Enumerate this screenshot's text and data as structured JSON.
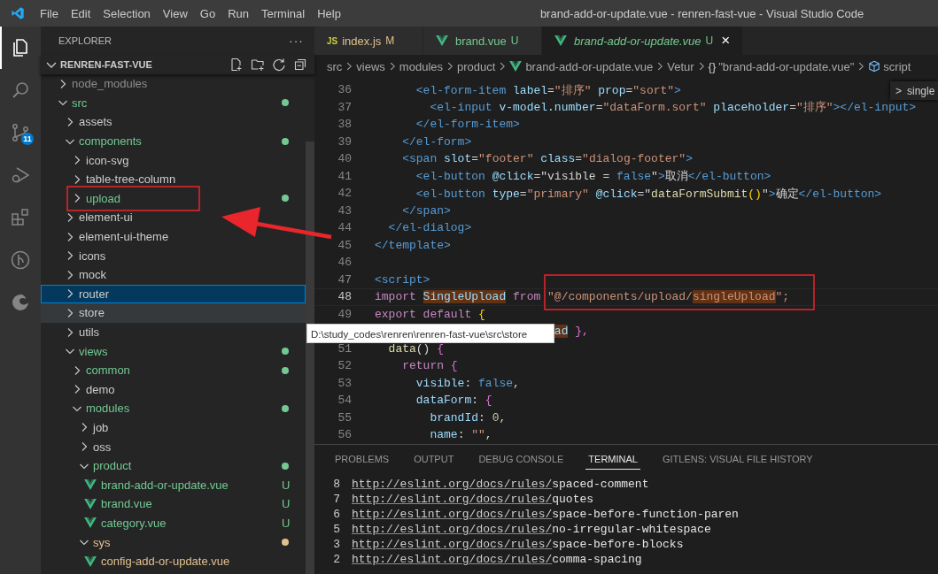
{
  "title_bar": {
    "menu": [
      "File",
      "Edit",
      "Selection",
      "View",
      "Go",
      "Run",
      "Terminal",
      "Help"
    ],
    "title": "brand-add-or-update.vue - renren-fast-vue - Visual Studio Code"
  },
  "activity_bar": [
    {
      "kind": "explorer",
      "selected": true
    },
    {
      "kind": "search",
      "selected": false
    },
    {
      "kind": "source-control",
      "selected": false,
      "badge": "11"
    },
    {
      "kind": "debug",
      "selected": false
    },
    {
      "kind": "extensions",
      "selected": false
    },
    {
      "kind": "git-graph",
      "selected": false
    },
    {
      "kind": "remote",
      "selected": false
    }
  ],
  "explorer": {
    "title": "EXPLORER",
    "more": "···",
    "section": "RENREN-FAST-VUE",
    "tree": [
      {
        "label": "node_modules",
        "kind": "folder",
        "expanded": false,
        "color": "#8c8c8c",
        "dot": false,
        "selected": false,
        "hovered": false
      },
      {
        "label": "src",
        "kind": "folder",
        "expanded": true,
        "color": "#73c991",
        "dot": true,
        "selected": false,
        "hovered": false,
        "children": [
          {
            "label": "assets",
            "kind": "folder",
            "expanded": false,
            "dot": false,
            "selected": false,
            "hovered": false
          },
          {
            "label": "components",
            "kind": "folder",
            "expanded": true,
            "color": "#73c991",
            "dot": true,
            "selected": false,
            "hovered": false,
            "children": [
              {
                "label": "icon-svg",
                "kind": "folder",
                "expanded": false,
                "dot": false,
                "selected": false,
                "hovered": false
              },
              {
                "label": "table-tree-column",
                "kind": "folder",
                "expanded": false,
                "dot": false,
                "selected": false,
                "hovered": false
              },
              {
                "label": "upload",
                "kind": "folder",
                "expanded": false,
                "color": "#73c991",
                "dot": true,
                "selected": false,
                "hovered": false
              }
            ]
          },
          {
            "label": "element-ui",
            "kind": "folder",
            "expanded": false,
            "dot": false,
            "selected": false,
            "hovered": false
          },
          {
            "label": "element-ui-theme",
            "kind": "folder",
            "expanded": false,
            "dot": false,
            "selected": false,
            "hovered": false
          },
          {
            "label": "icons",
            "kind": "folder",
            "expanded": false,
            "dot": false,
            "selected": false,
            "hovered": false
          },
          {
            "label": "mock",
            "kind": "folder",
            "expanded": false,
            "dot": false,
            "selected": false,
            "hovered": false
          },
          {
            "label": "router",
            "kind": "folder",
            "expanded": false,
            "dot": false,
            "selected": true,
            "hovered": false
          },
          {
            "label": "store",
            "kind": "folder",
            "expanded": false,
            "dot": false,
            "selected": false,
            "hovered": true
          },
          {
            "label": "utils",
            "kind": "folder",
            "expanded": false,
            "dot": false,
            "selected": false,
            "hovered": false
          },
          {
            "label": "views",
            "kind": "folder",
            "expanded": true,
            "color": "#73c991",
            "dot": true,
            "selected": false,
            "hovered": false,
            "children": [
              {
                "label": "common",
                "kind": "folder",
                "expanded": false,
                "color": "#73c991",
                "dot": true,
                "selected": false,
                "hovered": false
              },
              {
                "label": "demo",
                "kind": "folder",
                "expanded": false,
                "dot": false,
                "selected": false,
                "hovered": false
              },
              {
                "label": "modules",
                "kind": "folder",
                "expanded": true,
                "color": "#73c991",
                "dot": true,
                "selected": false,
                "hovered": false,
                "children": [
                  {
                    "label": "job",
                    "kind": "folder",
                    "expanded": false,
                    "dot": false,
                    "selected": false,
                    "hovered": false
                  },
                  {
                    "label": "oss",
                    "kind": "folder",
                    "expanded": false,
                    "dot": false,
                    "selected": false,
                    "hovered": false
                  },
                  {
                    "label": "product",
                    "kind": "folder",
                    "expanded": true,
                    "color": "#73c991",
                    "dot": true,
                    "selected": false,
                    "hovered": false,
                    "children": [
                      {
                        "label": "brand-add-or-update.vue",
                        "kind": "file",
                        "color": "#73c991",
                        "badge": "U",
                        "selected": false,
                        "hovered": false
                      },
                      {
                        "label": "brand.vue",
                        "kind": "file",
                        "color": "#73c991",
                        "badge": "U",
                        "selected": false,
                        "hovered": false
                      },
                      {
                        "label": "category.vue",
                        "kind": "file",
                        "color": "#73c991",
                        "badge": "U",
                        "selected": false,
                        "hovered": false
                      }
                    ]
                  },
                  {
                    "label": "sys",
                    "kind": "folder",
                    "expanded": true,
                    "color": "#e2c08d",
                    "dot": true,
                    "selected": false,
                    "hovered": false,
                    "children": [
                      {
                        "label": "config-add-or-update.vue",
                        "kind": "file",
                        "color": "#e2c08d",
                        "selected": false,
                        "hovered": false
                      }
                    ]
                  }
                ]
              }
            ]
          }
        ]
      }
    ],
    "tooltip": "D:\\study_codes\\renren\\renren-fast-vue\\src\\store"
  },
  "tabs": [
    {
      "label": "index.js",
      "kind": "js",
      "icon_label": "JS",
      "badge": "M",
      "color": "#e2c08d",
      "selected": false,
      "preview": false
    },
    {
      "label": "brand.vue",
      "kind": "vue",
      "badge": "U",
      "color": "#73c991",
      "selected": false,
      "preview": false
    },
    {
      "label": "brand-add-or-update.vue",
      "kind": "vue",
      "badge": "U",
      "color": "#73c991",
      "selected": true,
      "preview": true,
      "close": "×"
    }
  ],
  "breadcrumbs": [
    {
      "label": "src",
      "kind": "folder"
    },
    {
      "label": "views",
      "kind": "folder"
    },
    {
      "label": "modules",
      "kind": "folder"
    },
    {
      "label": "product",
      "kind": "folder"
    },
    {
      "label": "brand-add-or-update.vue",
      "kind": "vue"
    },
    {
      "label": "Vetur",
      "kind": "provider"
    },
    {
      "label": "\"brand-add-or-update.vue\"",
      "kind": "object",
      "icon_label": "{}"
    },
    {
      "label": "script",
      "kind": "module"
    }
  ],
  "breadcrumb_picker": {
    "chevron": ">",
    "label": "single"
  },
  "code": [
    {
      "number": "36",
      "current": false,
      "tokens": [
        {
          "text": "      <el-form-item",
          "kind": "tag"
        },
        {
          "text": " label",
          "kind": "attr"
        },
        {
          "text": "="
        },
        {
          "text": "\"排序\"",
          "kind": "str"
        },
        {
          "text": " prop",
          "kind": "attr"
        },
        {
          "text": "="
        },
        {
          "text": "\"sort\"",
          "kind": "str"
        },
        {
          "text": ">",
          "kind": "tag"
        }
      ]
    },
    {
      "number": "37",
      "current": false,
      "tokens": [
        {
          "text": "        <el-input",
          "kind": "tag"
        },
        {
          "text": " v-model.number",
          "kind": "attr"
        },
        {
          "text": "="
        },
        {
          "text": "\"dataForm.sort\"",
          "kind": "str"
        },
        {
          "text": " placeholder",
          "kind": "attr"
        },
        {
          "text": "="
        },
        {
          "text": "\"排序\"",
          "kind": "str"
        },
        {
          "text": "></el-input>",
          "kind": "tag"
        }
      ]
    },
    {
      "number": "38",
      "current": false,
      "tokens": [
        {
          "text": "      </el-form-item>",
          "kind": "tag"
        }
      ]
    },
    {
      "number": "39",
      "current": false,
      "tokens": [
        {
          "text": "    </el-form>",
          "kind": "tag"
        }
      ]
    },
    {
      "number": "40",
      "current": false,
      "tokens": [
        {
          "text": "    <span",
          "kind": "tag"
        },
        {
          "text": " slot",
          "kind": "attr"
        },
        {
          "text": "="
        },
        {
          "text": "\"footer\"",
          "kind": "str"
        },
        {
          "text": " class",
          "kind": "attr"
        },
        {
          "text": "="
        },
        {
          "text": "\"dialog-footer\"",
          "kind": "str"
        },
        {
          "text": ">",
          "kind": "tag"
        }
      ]
    },
    {
      "number": "41",
      "current": false,
      "tokens": [
        {
          "text": "      <el-button",
          "kind": "tag"
        },
        {
          "text": " @click",
          "kind": "attr"
        },
        {
          "text": "=\"visible = "
        },
        {
          "text": "false",
          "kind": "const"
        },
        {
          "text": "\""
        },
        {
          "text": ">",
          "kind": "tag"
        },
        {
          "text": "取消"
        },
        {
          "text": "</el-button>",
          "kind": "tag"
        }
      ]
    },
    {
      "number": "42",
      "current": false,
      "tokens": [
        {
          "text": "      <el-button",
          "kind": "tag"
        },
        {
          "text": " type",
          "kind": "attr"
        },
        {
          "text": "="
        },
        {
          "text": "\"primary\"",
          "kind": "str"
        },
        {
          "text": " @click",
          "kind": "attr"
        },
        {
          "text": "=\""
        },
        {
          "text": "dataFormSubmit",
          "kind": "fn"
        },
        {
          "text": "()",
          "kind": "brace"
        },
        {
          "text": "\""
        },
        {
          "text": ">",
          "kind": "tag"
        },
        {
          "text": "确定"
        },
        {
          "text": "</el-button>",
          "kind": "tag"
        }
      ]
    },
    {
      "number": "43",
      "current": false,
      "tokens": [
        {
          "text": "    </span>",
          "kind": "tag"
        }
      ]
    },
    {
      "number": "44",
      "current": false,
      "tokens": [
        {
          "text": "  </el-dialog>",
          "kind": "tag"
        }
      ]
    },
    {
      "number": "45",
      "current": false,
      "tokens": [
        {
          "text": "</template>",
          "kind": "tag"
        }
      ]
    },
    {
      "number": "46",
      "current": false
    },
    {
      "number": "47",
      "current": false,
      "tokens": [
        {
          "text": "<script>",
          "kind": "tag"
        }
      ]
    },
    {
      "number": "48",
      "current": true,
      "tokens": [
        {
          "text": "import ",
          "kind": "kw"
        },
        {
          "text": "SingleUpload",
          "kind": "var",
          "match": true
        },
        {
          "text": " from ",
          "kind": "kw"
        },
        {
          "text": "\"@/components/upload/",
          "kind": "str"
        },
        {
          "text": "singleUpload",
          "kind": "str",
          "match": true
        },
        {
          "text": "\";",
          "kind": "str"
        }
      ]
    },
    {
      "number": "49",
      "current": false,
      "tokens": [
        {
          "text": "export default ",
          "kind": "kw"
        },
        {
          "text": "{",
          "kind": "brace"
        }
      ]
    },
    {
      "current": false,
      "tokens": [
        {
          "text": "                          ad",
          "kind": "var",
          "match": true
        },
        {
          "text": " },",
          "kind": "brace2"
        }
      ]
    },
    {
      "number": "51",
      "current": false,
      "tokens": [
        {
          "text": "  data",
          "kind": "fn"
        },
        {
          "text": "() "
        },
        {
          "text": "{",
          "kind": "brace2"
        }
      ]
    },
    {
      "number": "52",
      "current": false,
      "tokens": [
        {
          "text": "    return ",
          "kind": "kw"
        },
        {
          "text": "{",
          "kind": "brace2"
        }
      ]
    },
    {
      "number": "53",
      "current": false,
      "tokens": [
        {
          "text": "      visible",
          "kind": "attr"
        },
        {
          "text": ": "
        },
        {
          "text": "false",
          "kind": "const"
        },
        {
          "text": ","
        }
      ]
    },
    {
      "number": "54",
      "current": false,
      "tokens": [
        {
          "text": "      dataForm",
          "kind": "attr"
        },
        {
          "text": ": "
        },
        {
          "text": "{",
          "kind": "brace3"
        }
      ]
    },
    {
      "number": "55",
      "current": false,
      "tokens": [
        {
          "text": "        brandId",
          "kind": "attr"
        },
        {
          "text": ": "
        },
        {
          "text": "0",
          "kind": "num"
        },
        {
          "text": ","
        }
      ]
    },
    {
      "number": "56",
      "current": false,
      "tokens": [
        {
          "text": "        name",
          "kind": "attr"
        },
        {
          "text": ": "
        },
        {
          "text": "\"\"",
          "kind": "str"
        },
        {
          "text": ","
        }
      ]
    }
  ],
  "panel": {
    "tabs": [
      {
        "label": "PROBLEMS",
        "selected": false
      },
      {
        "label": "OUTPUT",
        "selected": false
      },
      {
        "label": "DEBUG CONSOLE",
        "selected": false
      },
      {
        "label": "TERMINAL",
        "selected": true
      },
      {
        "label": "GITLENS: VISUAL FILE HISTORY",
        "selected": false
      }
    ],
    "terminal": [
      {
        "count": "8",
        "link": "http://eslint.org/docs/rules/",
        "rule": "spaced-comment"
      },
      {
        "count": "7",
        "link": "http://eslint.org/docs/rules/",
        "rule": "quotes"
      },
      {
        "count": "6",
        "link": "http://eslint.org/docs/rules/",
        "rule": "space-before-function-paren"
      },
      {
        "count": "5",
        "link": "http://eslint.org/docs/rules/",
        "rule": "no-irregular-whitespace"
      },
      {
        "count": "3",
        "link": "http://eslint.org/docs/rules/",
        "rule": "space-before-blocks"
      },
      {
        "count": "2",
        "link": "http://eslint.org/docs/rules/",
        "rule": "comma-spacing"
      }
    ]
  }
}
